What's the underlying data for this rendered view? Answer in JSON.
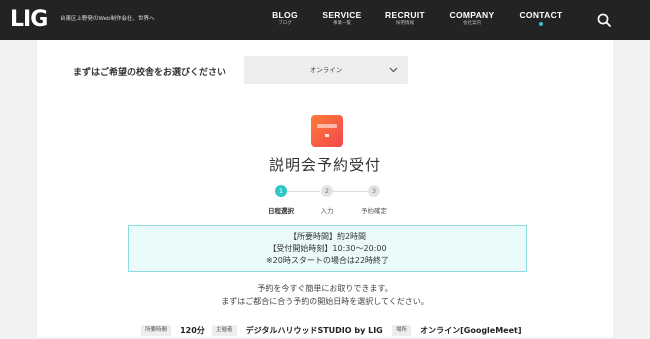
{
  "header": {
    "logo": "LIG",
    "tagline": "台東区上野発のWeb制作会社、世界へ",
    "nav": [
      {
        "label": "BLOG",
        "sub": "ブログ"
      },
      {
        "label": "SERVICE",
        "sub": "事業一覧"
      },
      {
        "label": "RECRUIT",
        "sub": "採用情報"
      },
      {
        "label": "COMPANY",
        "sub": "会社案内"
      },
      {
        "label": "CONTACT",
        "sub": ""
      }
    ],
    "search_icon": "search-icon",
    "accent_color": "#2fc6c6"
  },
  "school": {
    "label": "まずはご希望の校舎をお選びください",
    "selected": "オンライン"
  },
  "page": {
    "title": "説明会予約受付"
  },
  "steps": [
    {
      "number": "1",
      "label": "日程選択",
      "active": true
    },
    {
      "number": "2",
      "label": "入力",
      "active": false
    },
    {
      "number": "3",
      "label": "予約確定",
      "active": false
    }
  ],
  "info": {
    "line1": "【所要時間】約2時間",
    "line2": "【受付開始時刻】10:30～20:00",
    "line3": "※20時スタートの場合は22時終了"
  },
  "intro": {
    "line1": "予約を今すぐ簡単にお取りできます。",
    "line2": "まずはご都合に合う予約の開始日時を選択してください。"
  },
  "meta": [
    {
      "tag": "所要時間",
      "value": "120分"
    },
    {
      "tag": "主催者",
      "value": "デジタルハリウッドSTUDIO by LIG"
    },
    {
      "tag": "場所",
      "value": "オンライン[GoogleMeet]"
    }
  ]
}
